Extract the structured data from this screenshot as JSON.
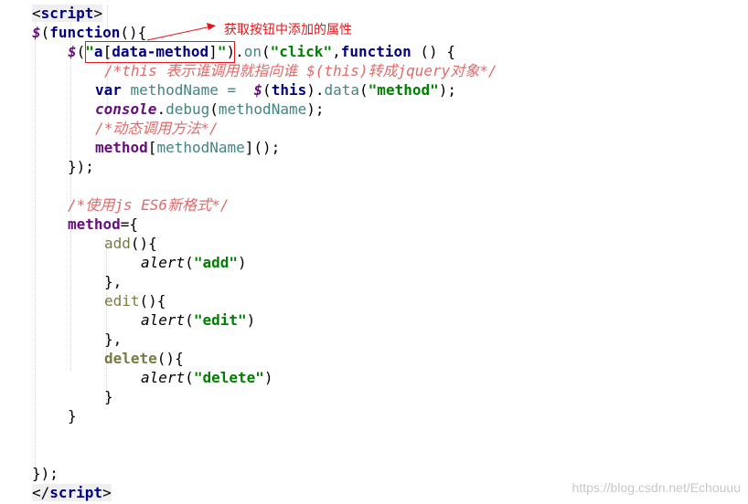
{
  "annotation": {
    "text": "获取按钮中添加的属性"
  },
  "watermark": "https://blog.csdn.net/Echouuu",
  "colors": {
    "annotation_red": "#e8141a",
    "string_green": "#008000",
    "comment": "#e06a6a",
    "keyword_navy": "#000080"
  },
  "code": {
    "l1": {
      "lt": "<",
      "tag": "script",
      "gt": ">"
    },
    "l2": {
      "dollar": "$",
      "paren_open": "(",
      "kw": "function",
      "rest": "(){"
    },
    "l3": {
      "dollar": "$",
      "paren_open": "(",
      "q1": "\"",
      "a": "a",
      "bracket_open": "[",
      "attr": "data-method",
      "bracket_close": "]",
      "q2": "\"",
      "paren_close": ")",
      "dot": ".",
      "on": "on",
      "po": "(",
      "click": "\"click\"",
      "comma": ",",
      "kw": "function",
      "rest": " () {"
    },
    "l4": {
      "comment": "/*this 表示谁调用就指向谁 $(this)转成jquery对象*/"
    },
    "l5": {
      "kw": "var",
      "name": " methodName = ",
      "dollar": "$",
      "po": "(",
      "this": "this",
      "pc": ")",
      "dot": ".",
      "data": "data",
      "po2": "(",
      "str": "\"method\"",
      "end": ");"
    },
    "l6": {
      "console": "console",
      "dot": ".",
      "debug": "debug",
      "po": "(",
      "arg": "methodName",
      "end": ");"
    },
    "l7": {
      "comment": "/*动态调用方法*/"
    },
    "l8": {
      "method": "method",
      "bo": "[",
      "arg": "methodName",
      "end": "]();"
    },
    "l9": {
      "text": "});"
    },
    "l11": {
      "comment": "/*使用js ES6新格式*/"
    },
    "l12": {
      "method": "method",
      "rest": "={"
    },
    "l13": {
      "name": "add",
      "rest": "(){"
    },
    "l14": {
      "alert": "alert",
      "po": "(",
      "str": "\"add\"",
      "pc": ")"
    },
    "l15": {
      "text": "},"
    },
    "l16": {
      "name": "edit",
      "rest": "(){"
    },
    "l17": {
      "alert": "alert",
      "po": "(",
      "str": "\"edit\"",
      "pc": ")"
    },
    "l18": {
      "text": "},"
    },
    "l19": {
      "name": "delete",
      "rest": "(){"
    },
    "l20": {
      "alert": "alert",
      "po": "(",
      "str": "\"delete\"",
      "pc": ")"
    },
    "l21": {
      "text": "}"
    },
    "l22": {
      "text": "}"
    },
    "l25": {
      "text": "});"
    },
    "l26": {
      "lt": "</",
      "tag": "script",
      "gt": ">"
    }
  }
}
